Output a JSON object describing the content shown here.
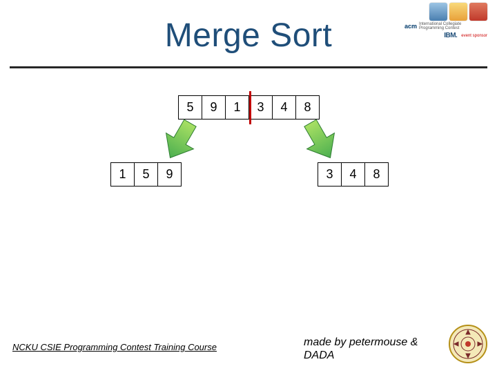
{
  "title": "Merge Sort",
  "logos": {
    "acm_label": "acm",
    "acm_sub": "International Collegiate Programming Contest",
    "ibm": "IBM.",
    "ibm_sub": "event sponsor"
  },
  "arrays": {
    "top": [
      "5",
      "9",
      "1",
      "3",
      "4",
      "8"
    ],
    "left": [
      "1",
      "5",
      "9"
    ],
    "right": [
      "3",
      "4",
      "8"
    ]
  },
  "footer": {
    "left": " NCKU CSIE Programming Contest Training Course ",
    "right_line1": "made by petermouse &",
    "right_line2": "DADA"
  }
}
